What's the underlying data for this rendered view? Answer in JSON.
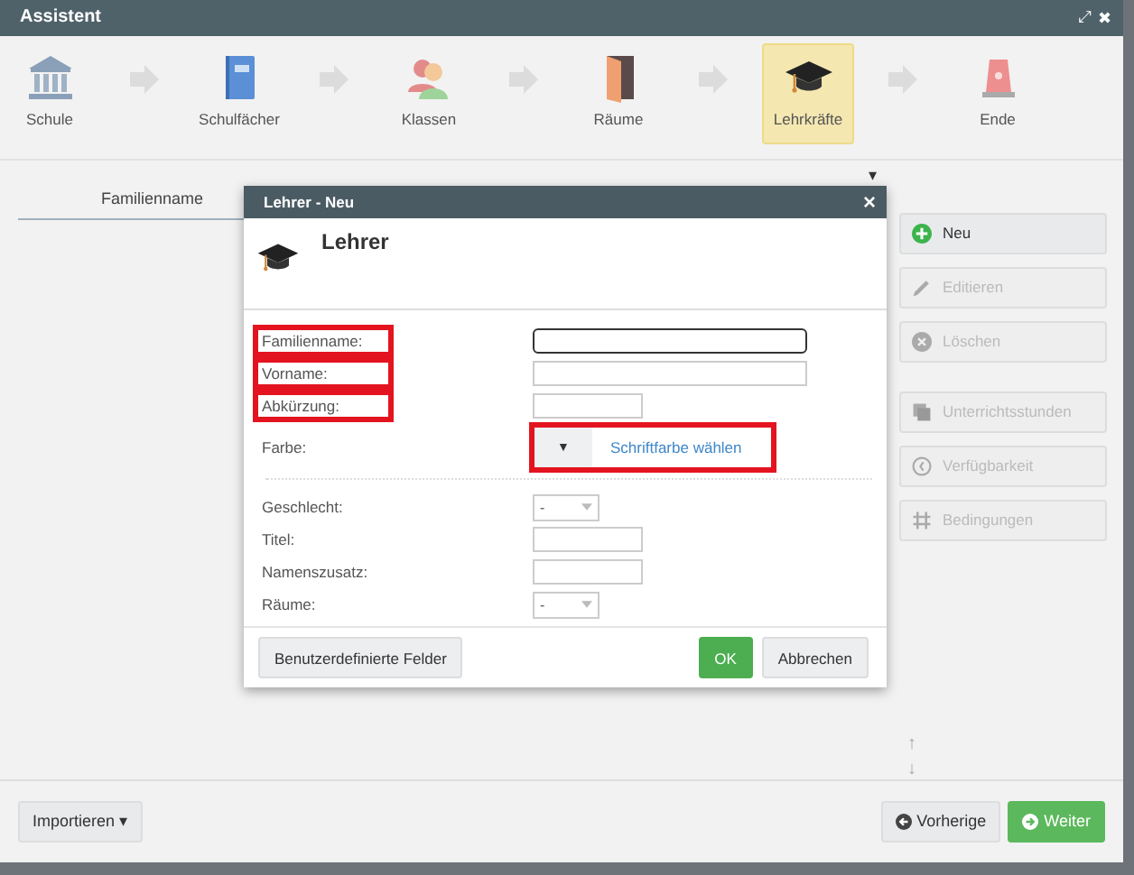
{
  "window": {
    "title": "Assistent",
    "controls": [
      "⤢",
      "✖"
    ]
  },
  "steps": [
    {
      "label": "Schule",
      "selected": false
    },
    {
      "label": "Schulfächer",
      "selected": false
    },
    {
      "label": "Klassen",
      "selected": false
    },
    {
      "label": "Räume",
      "selected": false
    },
    {
      "label": "Lehrkräfte",
      "selected": true
    },
    {
      "label": "Ende",
      "selected": false
    }
  ],
  "table": {
    "columns": [
      "Familienname"
    ],
    "menu_caret": "▾"
  },
  "side_buttons": [
    {
      "label": "Neu",
      "disabled": false
    },
    {
      "label": "Editieren",
      "disabled": true
    },
    {
      "label": "Löschen",
      "disabled": true
    },
    {
      "label": "Unterrichtsstunden",
      "disabled": true
    },
    {
      "label": "Verfügbarkeit",
      "disabled": true
    },
    {
      "label": "Bedingungen",
      "disabled": true
    }
  ],
  "sort_arrows": [
    "↑",
    "↓"
  ],
  "dialog": {
    "title": "Lehrer - Neu",
    "close": "×",
    "heading": "Lehrer",
    "fields": [
      {
        "label": "Familienname:",
        "kind": "text-wide",
        "focused": true,
        "highlighted": true
      },
      {
        "label": "Vorname:",
        "kind": "text-wide",
        "focused": false,
        "highlighted": true
      },
      {
        "label": "Abkürzung:",
        "kind": "text-short",
        "focused": false,
        "highlighted": true
      },
      {
        "label": "Farbe:",
        "kind": "color",
        "caret": "▼",
        "link": "Schriftfarbe wählen",
        "focused": false,
        "highlighted": false,
        "control_highlighted": true
      },
      {
        "kind": "divider"
      },
      {
        "label": "Geschlecht:",
        "kind": "select",
        "value": "-",
        "focused": false,
        "highlighted": false
      },
      {
        "label": "Titel:",
        "kind": "text-short",
        "focused": false,
        "highlighted": false
      },
      {
        "label": "Namenszusatz:",
        "kind": "text-short",
        "focused": false,
        "highlighted": false
      },
      {
        "label": "Räume:",
        "kind": "select",
        "value": "-",
        "focused": false,
        "highlighted": false
      }
    ],
    "custom_button": "Benutzerdefinierte Felder",
    "ok_button": "OK",
    "cancel_button": "Abbrechen"
  },
  "footer": {
    "import_button": "Importieren ▾",
    "back_button": "Vorherige",
    "next_button": "Weiter"
  }
}
